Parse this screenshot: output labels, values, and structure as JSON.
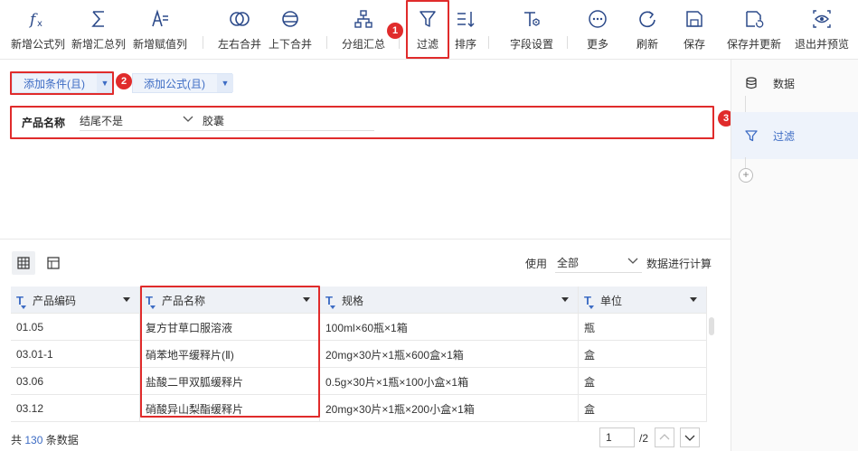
{
  "toolbar": {
    "items": [
      {
        "label": "新增公式列",
        "icon": "function-icon"
      },
      {
        "label": "新增汇总列",
        "icon": "sigma-icon"
      },
      {
        "label": "新增赋值列",
        "icon": "assign-icon"
      },
      {
        "label": "左右合并",
        "icon": "merge-horizontal-icon"
      },
      {
        "label": "上下合并",
        "icon": "merge-vertical-icon"
      },
      {
        "label": "分组汇总",
        "icon": "group-icon"
      },
      {
        "label": "过滤",
        "icon": "filter-icon"
      },
      {
        "label": "排序",
        "icon": "sort-icon"
      },
      {
        "label": "字段设置",
        "icon": "field-settings-icon"
      },
      {
        "label": "更多",
        "icon": "more-icon"
      },
      {
        "label": "刷新",
        "icon": "refresh-icon"
      },
      {
        "label": "保存",
        "icon": "save-icon"
      },
      {
        "label": "保存并更新",
        "icon": "save-update-icon"
      },
      {
        "label": "退出并预览",
        "icon": "preview-icon"
      }
    ]
  },
  "markers": {
    "m1": "1",
    "m2": "2",
    "m3": "3"
  },
  "filter": {
    "add_condition": "添加条件(且)",
    "add_formula": "添加公式(且)",
    "field": "产品名称",
    "operator": "结尾不是",
    "value": "胶囊"
  },
  "right_panel": {
    "items": [
      {
        "label": "数据",
        "icon": "database-icon"
      },
      {
        "label": "过滤",
        "icon": "filter-icon"
      }
    ]
  },
  "preview": {
    "use_label": "使用",
    "use_value": "全部",
    "calc_label": "数据进行计算"
  },
  "table": {
    "columns": [
      "产品编码",
      "产品名称",
      "规格",
      "单位"
    ],
    "rows": [
      [
        "01.05",
        "复方甘草口服溶液",
        "100ml×60瓶×1箱",
        "瓶"
      ],
      [
        "03.01-1",
        "硝苯地平缓释片(Ⅱ)",
        "20mg×30片×1瓶×600盒×1箱",
        "盒"
      ],
      [
        "03.06",
        "盐酸二甲双胍缓释片",
        "0.5g×30片×1瓶×100小盒×1箱",
        "盒"
      ],
      [
        "03.12",
        "硝酸异山梨酯缓释片",
        "20mg×30片×1瓶×200小盒×1箱",
        "盒"
      ]
    ]
  },
  "footer": {
    "total_prefix": "共",
    "total_count": "130",
    "total_suffix": "条数据",
    "page_current": "1",
    "page_total": "/2"
  },
  "colors": {
    "accent": "#3d6cc4",
    "highlight": "#e02b2b"
  }
}
